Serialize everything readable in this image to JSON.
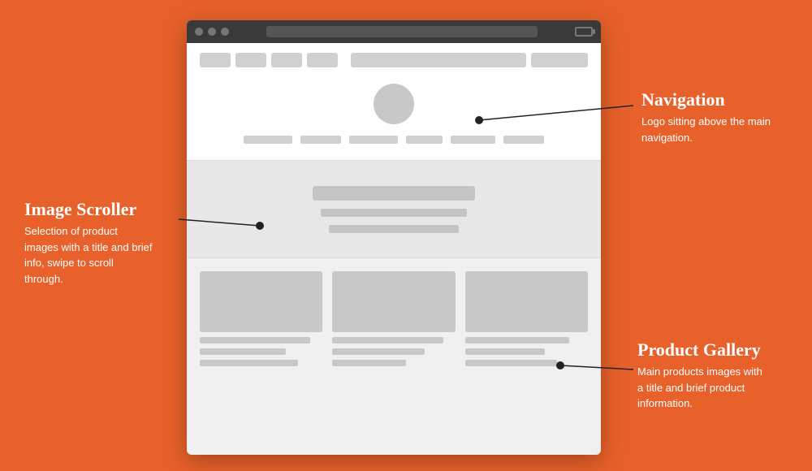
{
  "background_color": "#E8612A",
  "browser": {
    "chrome": {
      "buttons": [
        "btn1",
        "btn2",
        "btn3"
      ]
    }
  },
  "annotations": {
    "navigation": {
      "title": "Navigation",
      "description": "Logo sitting above the main navigation."
    },
    "image_scroller": {
      "title": "Image Scroller",
      "description": "Selection of product images with a title and brief info, swipe to scroll through."
    },
    "product_gallery": {
      "title": "Product Gallery",
      "description": "Main products images with a title and brief product information."
    }
  },
  "nav": {
    "tabs": [
      "tab1",
      "tab2",
      "tab3",
      "tab4"
    ],
    "menu_items_widths": [
      60,
      50,
      60,
      45,
      55,
      50
    ]
  },
  "scroller": {
    "title_bar_width": 200,
    "text_lines": [
      180,
      160
    ]
  },
  "gallery": {
    "items": [
      "item1",
      "item2",
      "item3"
    ]
  }
}
